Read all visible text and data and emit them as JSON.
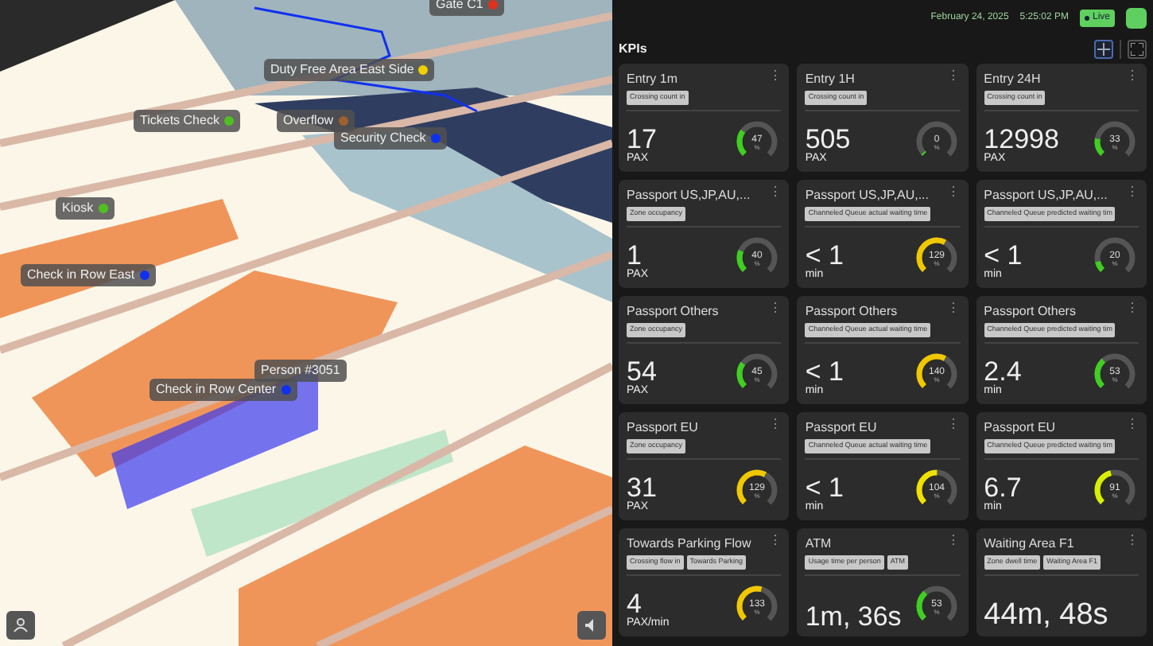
{
  "scene": {
    "labels": [
      {
        "text": "Gate C1",
        "color": "#e03020"
      },
      {
        "text": "Duty Free Area East Side",
        "color": "#f0d000"
      },
      {
        "text": "Tickets Check",
        "color": "#50c020"
      },
      {
        "text": "Overflow",
        "color": "#a06030"
      },
      {
        "text": "Security Check",
        "color": "#1030f0"
      },
      {
        "text": "Kiosk",
        "color": "#50c020"
      },
      {
        "text": "Check in Row East",
        "color": "#1030f0"
      },
      {
        "text": "Person #3051"
      },
      {
        "text": "Check in Row Center",
        "color": "#1030f0"
      }
    ]
  },
  "header": {
    "date": "February 24, 2025",
    "time": "5:25:02 PM",
    "live": "Live"
  },
  "panel": {
    "title": "KPIs"
  },
  "cards": [
    {
      "title": "Entry 1m",
      "menu": "⋮",
      "tags": [
        "Crossing count in"
      ],
      "value": "17",
      "unit": "PAX",
      "gauge": {
        "percent": "47",
        "sign": "%",
        "level": 0.3,
        "color": "#3ecf20"
      }
    },
    {
      "title": "Entry 1H",
      "menu": "⋮",
      "tags": [
        "Crossing count in"
      ],
      "value": "505",
      "unit": "PAX",
      "gauge": {
        "percent": "0",
        "sign": "%",
        "level": 0.02,
        "color": "#3ecf20"
      }
    },
    {
      "title": "Entry 24H",
      "menu": "⋮",
      "tags": [
        "Crossing count in"
      ],
      "value": "12998",
      "unit": "PAX",
      "gauge": {
        "percent": "33",
        "sign": "%",
        "level": 0.2,
        "color": "#3ecf20"
      }
    },
    {
      "title": "Passport US,JP,AU,...",
      "menu": "⋮",
      "tags": [
        "Zone occupancy"
      ],
      "value": "1",
      "unit": "PAX",
      "gauge": {
        "percent": "40",
        "sign": "%",
        "level": 0.25,
        "color": "#3ecf20"
      }
    },
    {
      "title": "Passport US,JP,AU,...",
      "menu": "⋮",
      "tags": [
        "Channeled Queue actual waiting time"
      ],
      "value": "< 1",
      "unit": "min",
      "gauge": {
        "percent": "129",
        "sign": "%",
        "level": 0.6,
        "color": "#f0c800"
      }
    },
    {
      "title": "Passport US,JP,AU,...",
      "menu": "⋮",
      "tags": [
        "Channeled Queue predicted waiting tim"
      ],
      "value": "< 1",
      "unit": "min",
      "gauge": {
        "percent": "20",
        "sign": "%",
        "level": 0.12,
        "color": "#3ecf20"
      }
    },
    {
      "title": "Passport Others",
      "menu": "⋮",
      "tags": [
        "Zone occupancy"
      ],
      "value": "54",
      "unit": "PAX",
      "gauge": {
        "percent": "45",
        "sign": "%",
        "level": 0.3,
        "color": "#3ecf20"
      }
    },
    {
      "title": "Passport Others",
      "menu": "⋮",
      "tags": [
        "Channeled Queue actual waiting time"
      ],
      "value": "< 1",
      "unit": "min",
      "gauge": {
        "percent": "140",
        "sign": "%",
        "level": 0.6,
        "color": "#f0c800"
      }
    },
    {
      "title": "Passport Others",
      "menu": "⋮",
      "tags": [
        "Channeled Queue predicted waiting tim"
      ],
      "value": "2.4",
      "unit": "min",
      "gauge": {
        "percent": "53",
        "sign": "%",
        "level": 0.35,
        "color": "#3ecf20"
      }
    },
    {
      "title": "Passport EU",
      "menu": "⋮",
      "tags": [
        "Zone occupancy"
      ],
      "value": "31",
      "unit": "PAX",
      "gauge": {
        "percent": "129",
        "sign": "%",
        "level": 0.6,
        "color": "#f0c800"
      }
    },
    {
      "title": "Passport EU",
      "menu": "⋮",
      "tags": [
        "Channeled Queue actual waiting time"
      ],
      "value": "< 1",
      "unit": "min",
      "gauge": {
        "percent": "104",
        "sign": "%",
        "level": 0.5,
        "color": "#f0e000"
      }
    },
    {
      "title": "Passport EU",
      "menu": "⋮",
      "tags": [
        "Channeled Queue predicted waiting tim"
      ],
      "value": "6.7",
      "unit": "min",
      "gauge": {
        "percent": "91",
        "sign": "%",
        "level": 0.45,
        "color": "#d8f000"
      }
    },
    {
      "title": "Towards Parking Flow",
      "menu": "⋮",
      "tags": [
        "Crossing flow in",
        "Towards Parking"
      ],
      "value": "4",
      "unit": "PAX/min",
      "gauge": {
        "percent": "133",
        "sign": "%",
        "level": 0.55,
        "color": "#f0c800"
      }
    },
    {
      "title": "ATM",
      "menu": "⋮",
      "tags": [
        "Usage time per person",
        "ATM"
      ],
      "value": "1m, 36s",
      "gauge": {
        "percent": "53",
        "sign": "%",
        "level": 0.35,
        "color": "#3ecf20"
      }
    },
    {
      "title": "Waiting Area F1",
      "menu": "⋮",
      "tags": [
        "Zone dwell time",
        "Waiting Area F1"
      ],
      "value": "44m, 48s"
    }
  ]
}
